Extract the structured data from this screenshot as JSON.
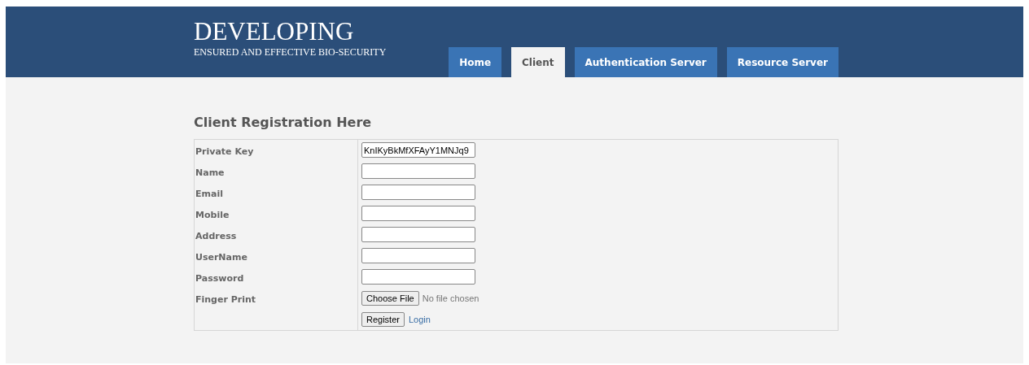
{
  "header": {
    "title": "DEVELOPING",
    "subtitle": "ENSURED AND EFFECTIVE BIO-SECURITY"
  },
  "tabs": [
    {
      "label": "Home",
      "selected": false
    },
    {
      "label": "Client",
      "selected": true
    },
    {
      "label": "Authentication Server",
      "selected": false
    },
    {
      "label": "Resource Server",
      "selected": false
    }
  ],
  "form": {
    "heading": "Client Registration Here",
    "rows": [
      {
        "kind": "text",
        "label": "Private Key",
        "value": "KnIKyBkMfXFAyY1MNJq9"
      },
      {
        "kind": "text",
        "label": "Name"
      },
      {
        "kind": "text",
        "label": "Email"
      },
      {
        "kind": "text",
        "label": "Mobile"
      },
      {
        "kind": "text",
        "label": "Address"
      },
      {
        "kind": "text",
        "label": "UserName"
      },
      {
        "kind": "password",
        "label": "Password"
      },
      {
        "kind": "file",
        "label": "Finger Print",
        "button": "Choose File",
        "status": "No file chosen"
      },
      {
        "kind": "actions",
        "button": "Register",
        "link": "Login"
      }
    ]
  }
}
